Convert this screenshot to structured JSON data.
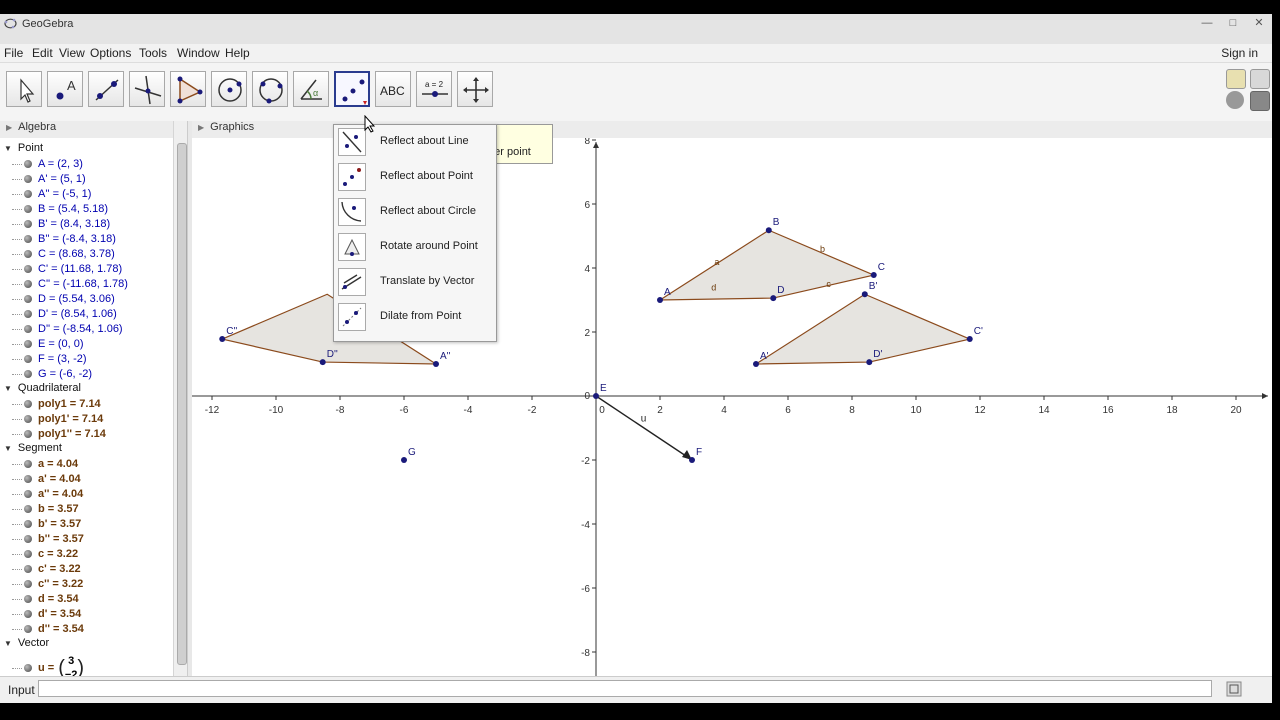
{
  "window": {
    "title": "GeoGebra"
  },
  "menu": [
    "File",
    "Edit",
    "View",
    "Options",
    "Tools",
    "Window",
    "Help"
  ],
  "signin": "Sign in",
  "toolbar": {
    "tools": [
      "move-tool",
      "point-tool",
      "line-tool",
      "perpendicular-tool",
      "polygon-tool",
      "circle-tool",
      "conic-tool",
      "angle-tool",
      "transform-tool",
      "text-tool",
      "slider-tool",
      "move-view-tool"
    ],
    "text_tool_label": "ABC",
    "slider_tool_label": "a = 2",
    "active_tool": "transform-tool"
  },
  "panels": {
    "algebra": "Algebra",
    "graphics": "Graphics"
  },
  "algebra": {
    "categories": [
      {
        "name": "Point",
        "items": [
          "A = (2, 3)",
          "A' = (5, 1)",
          "A'' = (-5, 1)",
          "B = (5.4, 5.18)",
          "B' = (8.4, 3.18)",
          "B'' = (-8.4, 3.18)",
          "C = (8.68, 3.78)",
          "C' = (11.68, 1.78)",
          "C'' = (-11.68, 1.78)",
          "D = (5.54, 3.06)",
          "D' = (8.54, 1.06)",
          "D'' = (-8.54, 1.06)",
          "E = (0, 0)",
          "F = (3, -2)",
          "G = (-6, -2)"
        ]
      },
      {
        "name": "Quadrilateral",
        "items": [
          "poly1 = 7.14",
          "poly1' = 7.14",
          "poly1'' = 7.14"
        ]
      },
      {
        "name": "Segment",
        "items": [
          "a = 4.04",
          "a' = 4.04",
          "a'' = 4.04",
          "b = 3.57",
          "b' = 3.57",
          "b'' = 3.57",
          "c = 3.22",
          "c' = 3.22",
          "c'' = 3.22",
          "d = 3.54",
          "d' = 3.54",
          "d'' = 3.54"
        ]
      },
      {
        "name": "Vector",
        "items": [
          "u ="
        ]
      }
    ],
    "vector_u": {
      "x": "3",
      "y": "−2"
    }
  },
  "dropdown": {
    "items": [
      {
        "label": "Reflect about Line",
        "icon": "reflect-line-icon"
      },
      {
        "label": "Reflect about Point",
        "icon": "reflect-point-icon"
      },
      {
        "label": "Reflect about Circle",
        "icon": "reflect-circle-icon"
      },
      {
        "label": "Rotate around Point",
        "icon": "rotate-point-icon"
      },
      {
        "label": "Translate by Vector",
        "icon": "translate-vector-icon"
      },
      {
        "label": "Dilate from Point",
        "icon": "dilate-point-icon"
      }
    ]
  },
  "tooltip": {
    "text": "nter point"
  },
  "input": {
    "label": "Input",
    "value": ""
  },
  "graphics": {
    "x_ticks": [
      "-12",
      "-10",
      "-8",
      "-6",
      "-4",
      "-2",
      "0",
      "2",
      "4",
      "6",
      "8",
      "10",
      "12",
      "14",
      "16",
      "18",
      "20"
    ],
    "y_ticks": [
      "8",
      "6",
      "4",
      "2",
      "0",
      "-2",
      "-4",
      "-6",
      "-8"
    ],
    "x_range": [
      -12.5,
      21
    ],
    "y_range": [
      -9.3,
      7.8
    ],
    "polygons": [
      {
        "name": "poly1",
        "vertices": [
          [
            2,
            3
          ],
          [
            5.4,
            5.18
          ],
          [
            8.68,
            3.78
          ],
          [
            5.54,
            3.06
          ]
        ]
      },
      {
        "name": "poly1'",
        "vertices": [
          [
            5,
            1
          ],
          [
            8.4,
            3.18
          ],
          [
            11.68,
            1.78
          ],
          [
            8.54,
            1.06
          ]
        ]
      },
      {
        "name": "poly1''",
        "vertices": [
          [
            -5,
            1
          ],
          [
            -8.4,
            3.18
          ],
          [
            -11.68,
            1.78
          ],
          [
            -8.54,
            1.06
          ]
        ]
      }
    ],
    "points": [
      {
        "label": "A",
        "x": 2,
        "y": 3
      },
      {
        "label": "B",
        "x": 5.4,
        "y": 5.18
      },
      {
        "label": "C",
        "x": 8.68,
        "y": 3.78
      },
      {
        "label": "D",
        "x": 5.54,
        "y": 3.06
      },
      {
        "label": "A'",
        "x": 5,
        "y": 1
      },
      {
        "label": "B'",
        "x": 8.4,
        "y": 3.18
      },
      {
        "label": "C'",
        "x": 11.68,
        "y": 1.78
      },
      {
        "label": "D'",
        "x": 8.54,
        "y": 1.06
      },
      {
        "label": "A''",
        "x": -5,
        "y": 1
      },
      {
        "label": "C''",
        "x": -11.68,
        "y": 1.78
      },
      {
        "label": "D''",
        "x": -8.54,
        "y": 1.06
      },
      {
        "label": "E",
        "x": 0,
        "y": 0
      },
      {
        "label": "F",
        "x": 3,
        "y": -2
      },
      {
        "label": "G",
        "x": -6,
        "y": -2
      }
    ],
    "segment_labels": [
      {
        "text": "a",
        "x": 3.7,
        "y": 4.1
      },
      {
        "text": "b",
        "x": 7.0,
        "y": 4.5
      },
      {
        "text": "c",
        "x": 7.2,
        "y": 3.4
      },
      {
        "text": "d",
        "x": 3.6,
        "y": 3.3
      }
    ],
    "vector": {
      "label": "u",
      "from": [
        0,
        0
      ],
      "to": [
        3,
        -2
      ]
    },
    "colors": {
      "point": "#1a1a7a",
      "poly_fill": "#d6d2cc",
      "poly_edge": "#8b4a1c",
      "axis": "#333333"
    }
  }
}
